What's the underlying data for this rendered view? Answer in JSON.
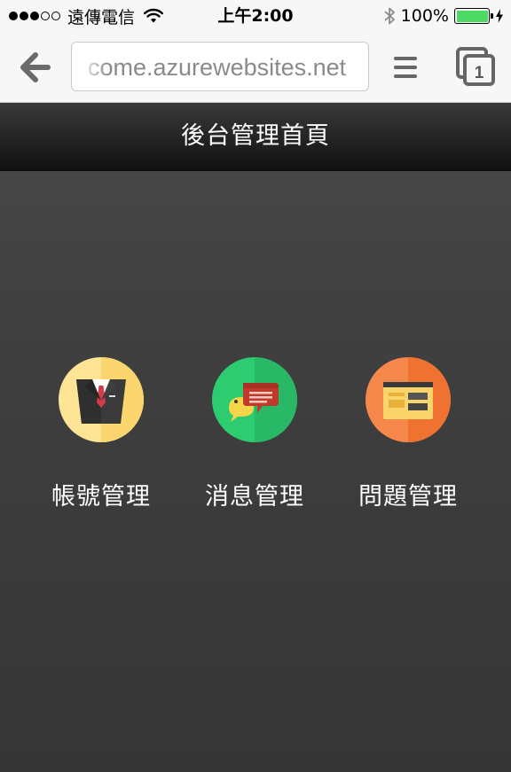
{
  "status_bar": {
    "carrier": "遠傳電信",
    "time": "上午2:00",
    "battery_percent": "100%",
    "battery_level": 1.0,
    "signal_bars_filled": 3,
    "signal_bars_total": 5
  },
  "browser": {
    "url": "come.azurewebsites.net",
    "open_tabs": "1",
    "icons": [
      "back-arrow-icon",
      "menu-icon",
      "tabs-icon"
    ]
  },
  "page": {
    "title": "後台管理首頁",
    "menu": [
      {
        "label": "帳號管理",
        "icon": "suit-icon",
        "color": "#fbdf7e"
      },
      {
        "label": "消息管理",
        "icon": "chat-bubbles-icon",
        "color": "#2ecc71"
      },
      {
        "label": "問題管理",
        "icon": "window-icon",
        "color": "#f37b3b"
      }
    ]
  },
  "colors": {
    "background": "#444444",
    "title_bar": "#1c1c1c",
    "battery_green": "#4cd964"
  }
}
